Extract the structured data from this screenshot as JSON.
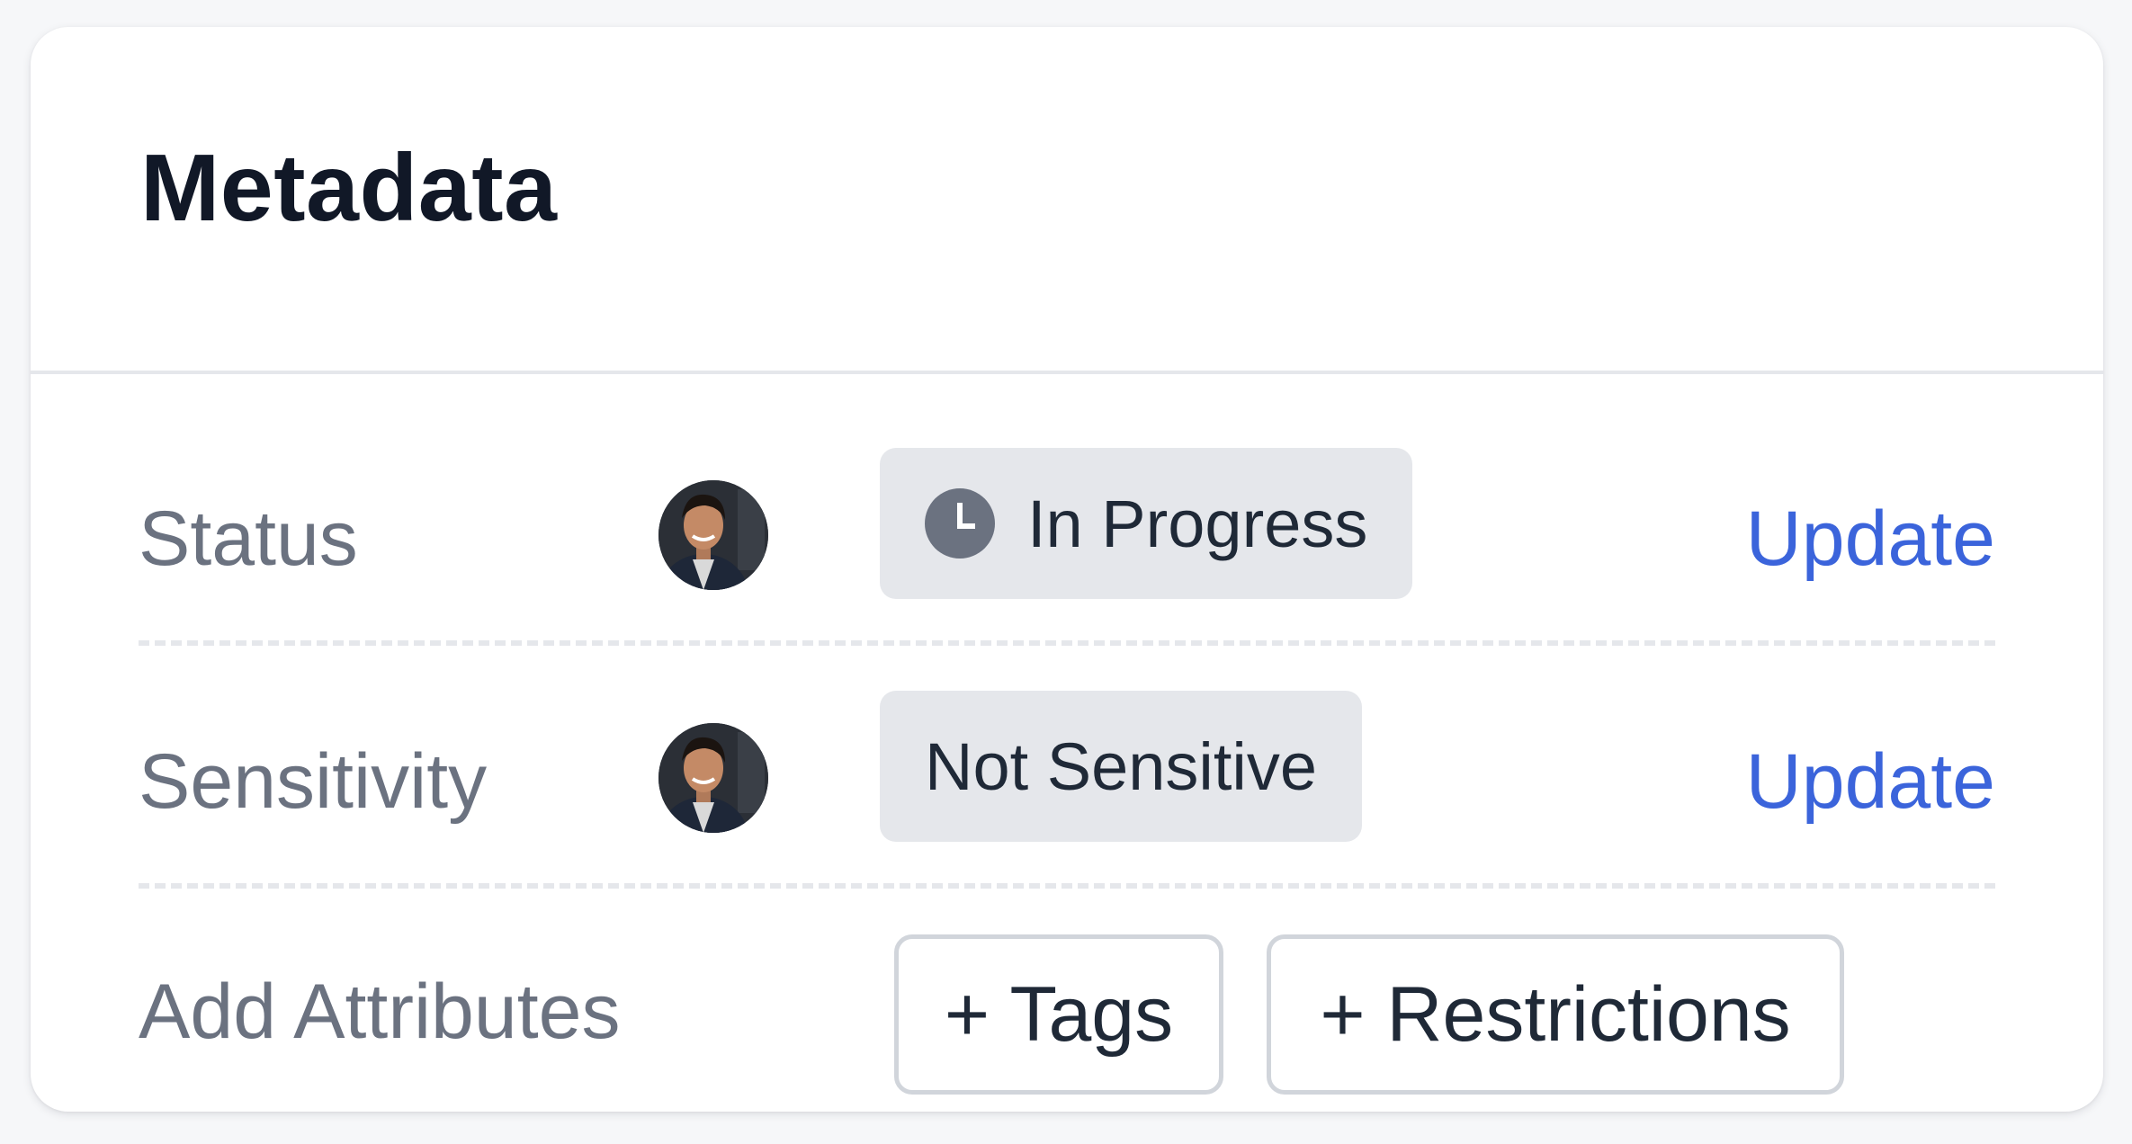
{
  "card": {
    "title": "Metadata"
  },
  "rows": [
    {
      "label": "Status",
      "value": "In Progress",
      "value_icon": "clock-icon",
      "action": "Update"
    },
    {
      "label": "Sensitivity",
      "value": "Not Sensitive",
      "action": "Update"
    },
    {
      "label": "Add Attributes",
      "buttons": [
        "+ Tags",
        "+ Restrictions"
      ]
    }
  ],
  "colors": {
    "link": "#3b64db",
    "label": "#6b7280",
    "title": "#111827",
    "pill_bg": "#e5e7eb",
    "clock_icon": "#6b7280"
  }
}
